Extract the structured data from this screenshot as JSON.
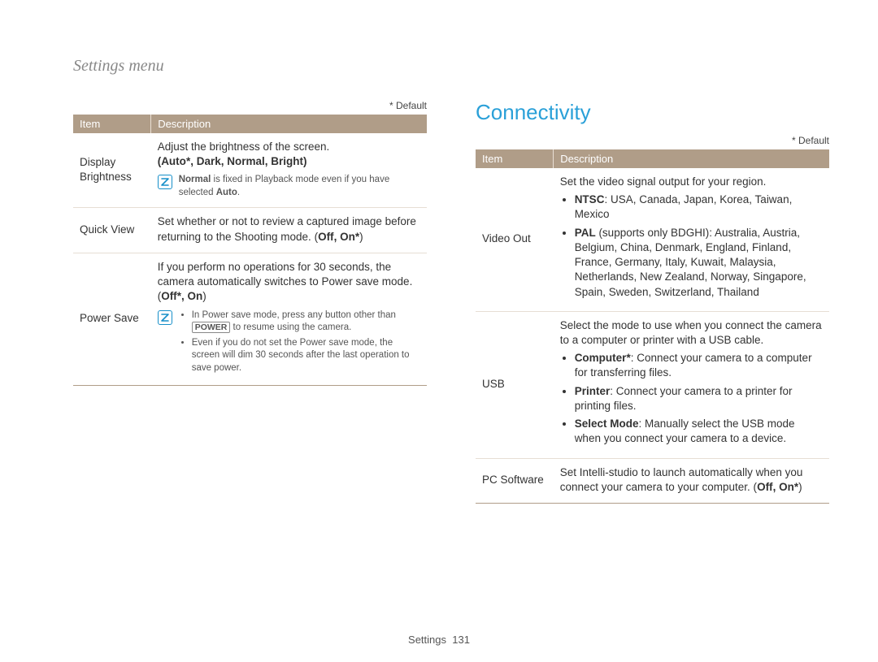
{
  "breadcrumb": "Settings menu",
  "default_note": "* Default",
  "table_headers": {
    "item": "Item",
    "description": "Description"
  },
  "left_table": {
    "rows": [
      {
        "item": "Display Brightness",
        "lead": "Adjust the brightness of the screen.",
        "options_prefix": "(",
        "options": [
          "Auto",
          "Dark",
          "Normal",
          "Bright"
        ],
        "default_option": "Auto",
        "options_suffix": ")",
        "note_inline_pre": "Normal",
        "note_inline_rest": " is fixed in Playback mode even if you have selected ",
        "note_inline_post": "Auto",
        "note_tail": "."
      },
      {
        "item": "Quick View",
        "lead": "Set whether or not to review a captured image before returning to the Shooting mode. (",
        "options": [
          "Off",
          "On"
        ],
        "default_option": "On",
        "options_suffix": ")"
      },
      {
        "item": "Power Save",
        "lead": "If you perform no operations for 30 seconds, the camera automatically switches to Power save mode. (",
        "options": [
          "Off",
          "On"
        ],
        "default_option": "Off",
        "options_suffix": ")",
        "note_bullets": [
          {
            "pre": "In Power save mode, press any button other than ",
            "kbd": "POWER",
            "post": " to resume using the camera."
          },
          {
            "text": "Even if you do not set the Power save mode, the screen will dim 30 seconds after the last operation to save power."
          }
        ]
      }
    ]
  },
  "right_section_heading": "Connectivity",
  "right_table": {
    "rows": [
      {
        "item": "Video Out",
        "lead": "Set the video signal output for your region.",
        "bullets": [
          {
            "label": "NTSC",
            "text": ": USA, Canada, Japan, Korea, Taiwan, Mexico"
          },
          {
            "label": "PAL",
            "paren": " (supports only BDGHI)",
            "text": ": Australia, Austria, Belgium, China, Denmark, England, Finland, France, Germany, Italy, Kuwait, Malaysia, Netherlands, New Zealand, Norway, Singapore, Spain, Sweden, Switzerland, Thailand"
          }
        ]
      },
      {
        "item": "USB",
        "lead": "Select the mode to use when you connect the camera to a computer or printer with a USB cable.",
        "bullets": [
          {
            "label": "Computer",
            "default": true,
            "text": ": Connect your camera to a computer for transferring files."
          },
          {
            "label": "Printer",
            "text": ": Connect your camera to a printer for printing files."
          },
          {
            "label": "Select Mode",
            "text": ": Manually select the USB mode when you connect your camera to a device."
          }
        ]
      },
      {
        "item": "PC Software",
        "lead": "Set Intelli-studio to launch automatically when you connect your camera to your computer. (",
        "options": [
          "Off",
          "On"
        ],
        "default_option": "On",
        "options_suffix": ")"
      }
    ]
  },
  "footer": {
    "section": "Settings",
    "page": "131"
  }
}
